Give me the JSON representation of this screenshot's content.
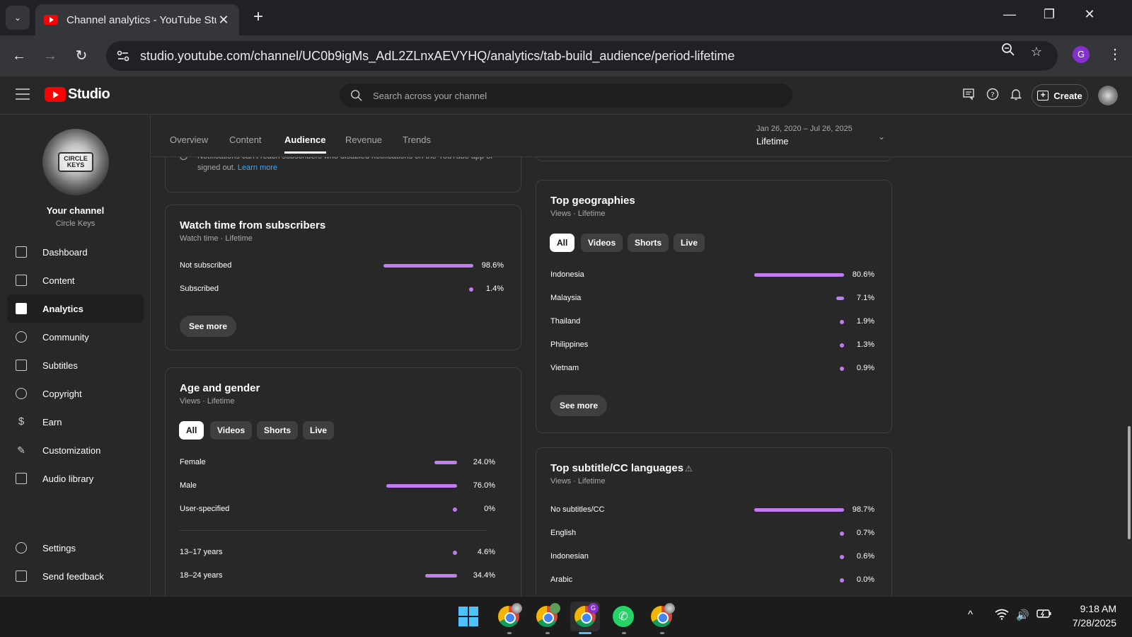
{
  "browser": {
    "tab_title": "Channel analytics - YouTube Studio",
    "url": "studio.youtube.com/channel/UC0b9igMs_AdL2ZLnxAEVYHQ/analytics/tab-build_audience/period-lifetime",
    "profile_initial": "G"
  },
  "header": {
    "logo_text": "Studio",
    "search_placeholder": "Search across your channel",
    "create_label": "Create"
  },
  "sidebar": {
    "channel_label": "Your channel",
    "channel_name": "Circle Keys",
    "avatar_text": "CIRCLE KEYS",
    "items": [
      {
        "label": "Dashboard",
        "icon": "dashboard-icon"
      },
      {
        "label": "Content",
        "icon": "content-icon"
      },
      {
        "label": "Analytics",
        "icon": "analytics-icon",
        "active": true
      },
      {
        "label": "Community",
        "icon": "community-icon"
      },
      {
        "label": "Subtitles",
        "icon": "subtitles-icon"
      },
      {
        "label": "Copyright",
        "icon": "copyright-icon"
      },
      {
        "label": "Earn",
        "icon": "earn-icon"
      },
      {
        "label": "Customization",
        "icon": "customization-icon"
      },
      {
        "label": "Audio library",
        "icon": "audio-library-icon"
      }
    ],
    "bottom_items": [
      {
        "label": "Settings",
        "icon": "settings-icon"
      },
      {
        "label": "Send feedback",
        "icon": "feedback-icon"
      }
    ]
  },
  "subtabs": [
    "Overview",
    "Content",
    "Audience",
    "Revenue",
    "Trends"
  ],
  "period": {
    "range": "Jan 26, 2020 – Jul 26, 2025",
    "label": "Lifetime"
  },
  "notice": {
    "text": "Notifications can't reach subscribers who disabled notifications on the YouTube app or signed out.",
    "link": "Learn more"
  },
  "watch_time": {
    "title": "Watch time from subscribers",
    "subtitle": "Watch time · Lifetime",
    "rows": [
      {
        "label": "Not subscribed",
        "value": "98.6%",
        "pct": 98.6
      },
      {
        "label": "Subscribed",
        "value": "1.4%",
        "pct": 1.4
      }
    ],
    "see_more": "See more"
  },
  "age_gender": {
    "title": "Age and gender",
    "subtitle": "Views · Lifetime",
    "filters": [
      "All",
      "Videos",
      "Shorts",
      "Live"
    ],
    "gender_rows": [
      {
        "label": "Female",
        "value": "24.0%",
        "pct": 24.0
      },
      {
        "label": "Male",
        "value": "76.0%",
        "pct": 76.0
      },
      {
        "label": "User-specified",
        "value": "0%",
        "pct": 0
      }
    ],
    "age_rows": [
      {
        "label": "13–17 years",
        "value": "4.6%",
        "pct": 4.6
      },
      {
        "label": "18–24 years",
        "value": "34.4%",
        "pct": 34.4
      }
    ]
  },
  "geographies": {
    "title": "Top geographies",
    "subtitle": "Views · Lifetime",
    "filters": [
      "All",
      "Videos",
      "Shorts",
      "Live"
    ],
    "rows": [
      {
        "label": "Indonesia",
        "value": "80.6%",
        "pct": 80.6
      },
      {
        "label": "Malaysia",
        "value": "7.1%",
        "pct": 7.1
      },
      {
        "label": "Thailand",
        "value": "1.9%",
        "pct": 1.9
      },
      {
        "label": "Philippines",
        "value": "1.3%",
        "pct": 1.3
      },
      {
        "label": "Vietnam",
        "value": "0.9%",
        "pct": 0.9
      }
    ],
    "see_more": "See more"
  },
  "subtitles": {
    "title": "Top subtitle/CC languages",
    "subtitle": "Views · Lifetime",
    "rows": [
      {
        "label": "No subtitles/CC",
        "value": "98.7%",
        "pct": 98.7
      },
      {
        "label": "English",
        "value": "0.7%",
        "pct": 0.7
      },
      {
        "label": "Indonesian",
        "value": "0.6%",
        "pct": 0.6
      },
      {
        "label": "Arabic",
        "value": "0.0%",
        "pct": 0.0
      }
    ]
  },
  "taskbar": {
    "time": "9:18 AM",
    "date": "7/28/2025"
  },
  "colors": {
    "accent": "#c27cf0",
    "background": "#282828",
    "link": "#3ea6ff"
  }
}
